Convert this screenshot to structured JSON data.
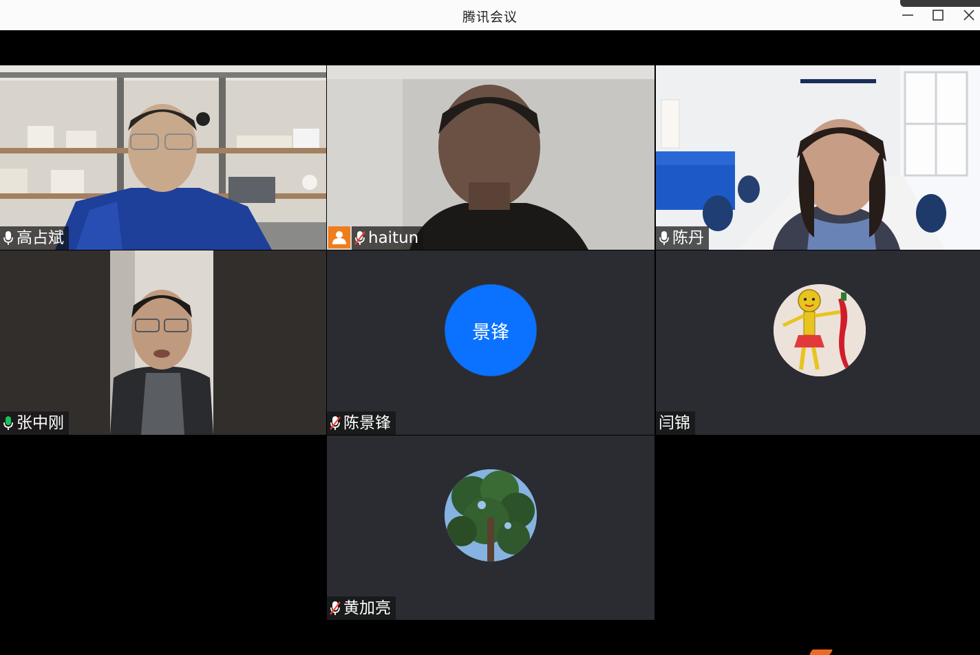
{
  "window": {
    "title": "腾讯会议",
    "controls": {
      "minimize_icon": "minimize-icon",
      "maximize_icon": "maximize-icon",
      "close_icon": "close-icon"
    }
  },
  "participants": [
    {
      "name": "高占斌",
      "mic": "on",
      "video": "on",
      "scene": "bookshelf-office"
    },
    {
      "name": "haitun",
      "mic": "muted",
      "video": "on",
      "scene": "plain-white-room",
      "badge_icon": "person-badge-icon"
    },
    {
      "name": "陈丹",
      "mic": "on",
      "video": "on",
      "scene": "meeting-room"
    },
    {
      "name": "张中刚",
      "mic": "speaking",
      "video": "on",
      "scene": "portrait-phone-camera"
    },
    {
      "name": "陈景锋",
      "mic": "muted",
      "video": "off",
      "avatar_text": "景锋"
    },
    {
      "name": "闫锦",
      "mic": "none",
      "video": "off",
      "avatar_image": "child-drawing-avatar"
    },
    {
      "name": "黄加亮",
      "mic": "muted",
      "video": "off",
      "avatar_image": "tree-avatar"
    }
  ],
  "colors": {
    "initials_avatar": "#0a72ff",
    "speaking_mic": "#17c15a",
    "active_border": "#17c15a",
    "badge": "#f07d1c",
    "tile_background": "#2a2c31"
  }
}
